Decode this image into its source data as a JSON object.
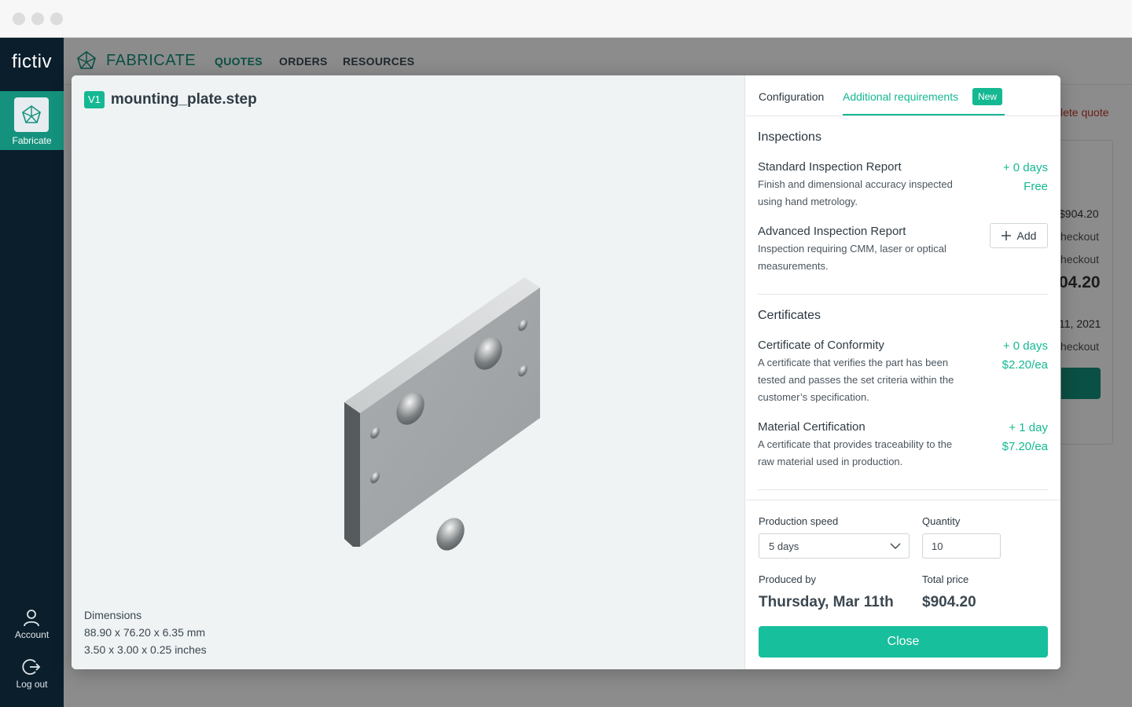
{
  "app": {
    "logo": "fictiv",
    "brand": "FABRICATE",
    "nav": [
      "QUOTES",
      "ORDERS",
      "RESOURCES"
    ],
    "sidebar": {
      "active_label": "Fabricate",
      "account_label": "Account",
      "logout_label": "Log out"
    }
  },
  "background_page": {
    "delete_link": "lete quote",
    "price_small": "$904.20",
    "line1": "heckout",
    "line2": "heckout",
    "price_big": "04.20",
    "date": "11, 2021",
    "line3": "heckout"
  },
  "viewer": {
    "version_badge": "V1",
    "file_name": "mounting_plate.step",
    "dimensions_label": "Dimensions",
    "dimensions_mm": "88.90 x 76.20 x 6.35 mm",
    "dimensions_in": "3.50 x 3.00 x 0.25 inches"
  },
  "panel": {
    "tabs": {
      "configuration": "Configuration",
      "additional": "Additional requirements",
      "new_badge": "New"
    },
    "inspections": {
      "title": "Inspections",
      "standard": {
        "name": "Standard Inspection Report",
        "desc": "Finish and dimensional accuracy inspected using hand metrology.",
        "days": "+ 0 days",
        "price": "Free"
      },
      "advanced": {
        "name": "Advanced Inspection Report",
        "desc": "Inspection requiring CMM, laser or optical measurements.",
        "add_label": "Add"
      }
    },
    "certificates": {
      "title": "Certificates",
      "conformity": {
        "name": "Certificate of Conformity",
        "desc": "A certificate that verifies the part has been tested and passes the set criteria within the customer’s specification.",
        "days": "+ 0 days",
        "price": "$2.20/ea"
      },
      "material": {
        "name": "Material Certification",
        "desc": "A certificate that provides traceability to the raw material used in production.",
        "days": "+ 1 day",
        "price": "$7.20/ea"
      }
    },
    "footer": {
      "speed_label": "Production speed",
      "speed_value": "5 days",
      "quantity_label": "Quantity",
      "quantity_value": "10",
      "produced_label": "Produced by",
      "produced_value": "Thursday, Mar 11th",
      "total_label": "Total price",
      "total_value": "$904.20",
      "close_label": "Close"
    }
  },
  "colors": {
    "accent": "#14b892",
    "sidebar": "#0b1e2c",
    "brand_green": "#14927d"
  }
}
